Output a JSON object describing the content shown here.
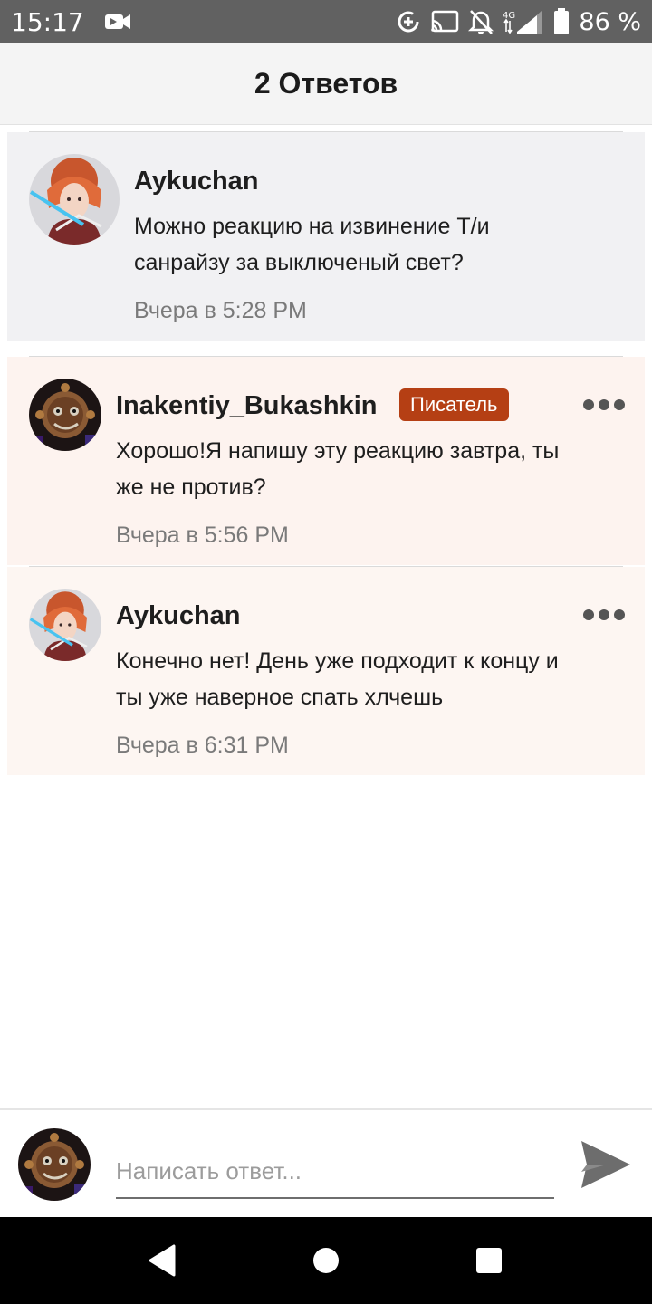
{
  "status_bar": {
    "time": "15:17",
    "battery_percent": "86 %"
  },
  "header": {
    "title": "2 Ответов"
  },
  "parent_comment": {
    "username": "Aykuchan",
    "text_line1": "Можно реакцию на извинение Т/и",
    "text_line2": "санрайзу за выключеный свет?",
    "time": "Вчера в 5:28 PM",
    "avatar": "anime-avatar"
  },
  "replies": [
    {
      "username": "Inakentiy_Bukashkin",
      "badge": "Писатель",
      "text_line1": "Хорошо!Я напишу эту реакцию завтра, ты",
      "text_line2": "же не против?",
      "time": "Вчера в 5:56 PM",
      "avatar": "robot-avatar"
    },
    {
      "username": "Aykuchan",
      "text_line1": "Конечно нет! День уже подходит к концу и",
      "text_line2": "ты уже наверное спать хлчешь",
      "time": "Вчера в 6:31 PM",
      "avatar": "anime-avatar"
    }
  ],
  "composer": {
    "placeholder": "Написать ответ..."
  },
  "colors": {
    "status_bar": "#616161",
    "badge": "#b53f14",
    "reply_bg": "#fdf3ef",
    "parent_bg": "#f1f1f3"
  }
}
